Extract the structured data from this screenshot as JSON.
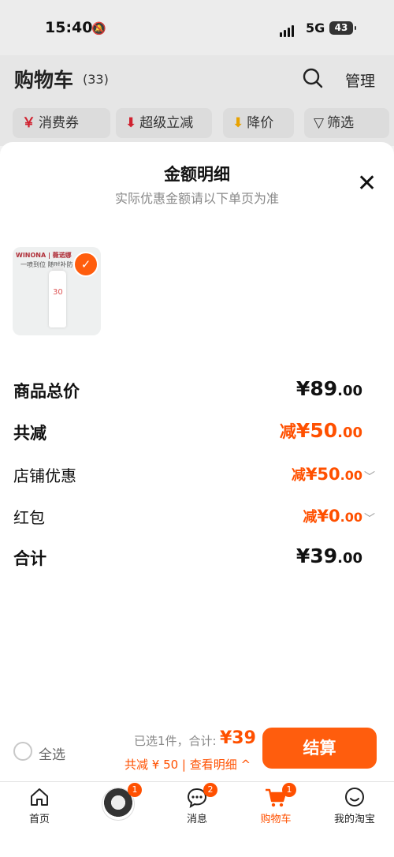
{
  "status_bar": {
    "time": "15:40",
    "network": "5G",
    "battery": "43"
  },
  "cart": {
    "title": "购物车",
    "count": "(33)",
    "manage_label": "管理",
    "chips": [
      {
        "icon": "￥",
        "label": "消费券"
      },
      {
        "icon": "⬇",
        "label": "超级立减"
      },
      {
        "icon": "⬇",
        "label": "降价"
      },
      {
        "icon": "▽",
        "label": "筛选"
      }
    ]
  },
  "sheet": {
    "title": "金额明细",
    "subtitle": "实际优惠金额请以下单页为准",
    "product": {
      "brand": "WINONA | 薇诺娜",
      "slogan": "一喷到位 随时补防",
      "label": "30"
    },
    "rows": [
      {
        "label": "商品总价",
        "prefix": "",
        "main": "¥89",
        "cents": ".00"
      },
      {
        "label": "共减",
        "prefix": "减",
        "main": "¥50",
        "cents": ".00"
      },
      {
        "label": "店铺优惠",
        "prefix": "减",
        "main": "¥50",
        "cents": ".00"
      },
      {
        "label": "红包",
        "prefix": "减",
        "main": "¥0",
        "cents": ".00"
      },
      {
        "label": "合计",
        "prefix": "",
        "main": "¥39",
        "cents": ".00"
      }
    ]
  },
  "bottom_bar": {
    "select_all": "全选",
    "selected_info": "已选1件，合计:",
    "total": "¥39",
    "discount_line": "共减 ¥ 50 | 查看明细 ^",
    "checkout": "结算"
  },
  "tabs": [
    {
      "label": "首页",
      "badge": ""
    },
    {
      "label": "",
      "badge": "1"
    },
    {
      "label": "消息",
      "badge": "2"
    },
    {
      "label": "购物车",
      "badge": "1"
    },
    {
      "label": "我的淘宝",
      "badge": ""
    }
  ],
  "colors": {
    "accent": "#ff5000",
    "checkout": "#ff5d0d"
  }
}
